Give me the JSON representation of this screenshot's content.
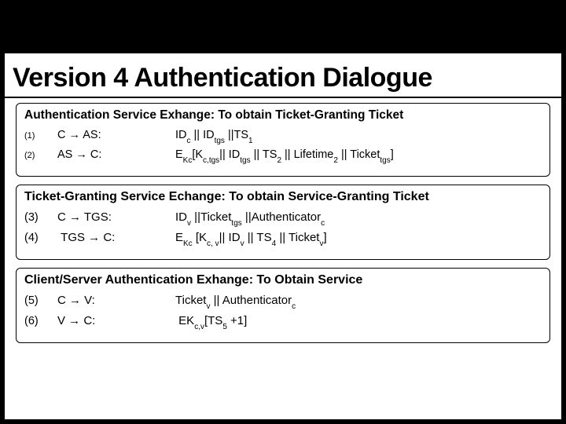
{
  "title": "Version 4 Authentication Dialogue",
  "section1": {
    "header": "Authentication Service Exhange: To obtain Ticket-Granting Ticket",
    "rows": [
      {
        "step": "(1)",
        "dir": "C → AS:",
        "msg": "IDc || IDtgs ||TS1"
      },
      {
        "step": "(2)",
        "dir": "AS → C:",
        "msg": "EKc[Kc,tgs|| IDtgs || TS2 || Lifetime2 || Tickettgs]"
      }
    ]
  },
  "section2": {
    "header": "Ticket-Granting Service Echange: To obtain Service-Granting Ticket",
    "rows": [
      {
        "step": "(3)",
        "dir": "C → TGS:",
        "msg": "IDv ||Tickettgs ||Authenticatorc"
      },
      {
        "step": "(4)",
        "dir": "TGS → C:",
        "msg": "EKc [Kc,v|| IDv || TS4 || Ticketv]"
      }
    ]
  },
  "section3": {
    "header": "Client/Server Authentication Exhange: To Obtain Service",
    "rows": [
      {
        "step": "(5)",
        "dir": "C → V:",
        "msg": "Ticketv || Authenticatorc"
      },
      {
        "step": "(6)",
        "dir": "V → C:",
        "msg": "EKc,v[TS5 +1]"
      }
    ]
  }
}
